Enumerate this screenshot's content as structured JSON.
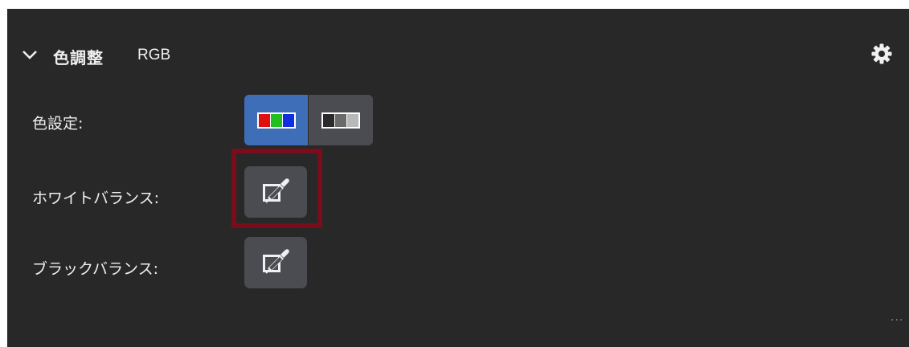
{
  "panel": {
    "section_title": "色調整",
    "section_mode": "RGB",
    "collapse_icon": "chevron-down-icon",
    "settings_icon": "gear-icon",
    "more_label": "..."
  },
  "rows": {
    "color_setting_label": "色設定:",
    "white_balance_label": "ホワイトバランス:",
    "black_balance_label": "ブラックバランス:"
  },
  "color_setting": {
    "options": [
      {
        "icon": "rgb-color-icon",
        "selected": true
      },
      {
        "icon": "grayscale-icon",
        "selected": false
      }
    ]
  },
  "balance_buttons": {
    "white_icon": "eyedropper-icon",
    "black_icon": "eyedropper-icon",
    "highlighted": "white-balance"
  },
  "colors": {
    "panel_bg": "#282828",
    "button_bg": "#4a4c52",
    "active_bg": "#3e6eb7",
    "highlight_border": "#7a0d1b"
  }
}
